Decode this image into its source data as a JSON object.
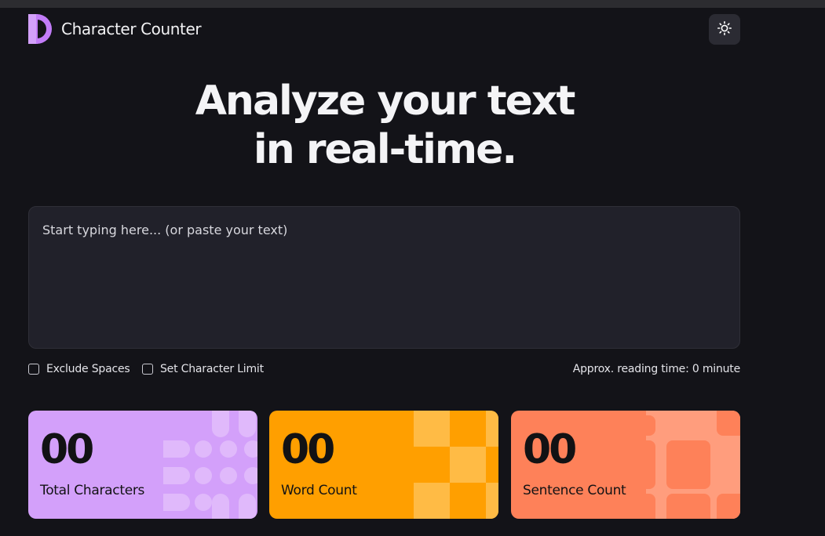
{
  "app": {
    "title": "Character Counter",
    "logo_icon": "logo-half-circle-icon",
    "theme_toggle_icon": "sun-icon"
  },
  "hero": {
    "line1": "Analyze your text",
    "line2": "in real-time."
  },
  "editor": {
    "placeholder": "Start typing here... (or paste your text)",
    "value": ""
  },
  "options": {
    "exclude_spaces": {
      "label": "Exclude Spaces",
      "checked": false
    },
    "char_limit": {
      "label": "Set Character Limit",
      "checked": false
    },
    "reading_time": "Approx. reading time: 0 minute"
  },
  "stats": [
    {
      "value": "00",
      "label": "Total Characters",
      "color": "#d3a0fa"
    },
    {
      "value": "00",
      "label": "Word Count",
      "color": "#ff9f00"
    },
    {
      "value": "00",
      "label": "Sentence Count",
      "color": "#fe8159"
    }
  ],
  "colors": {
    "background": "#131318",
    "panel": "#21212a",
    "logo": "#c27cf8"
  }
}
